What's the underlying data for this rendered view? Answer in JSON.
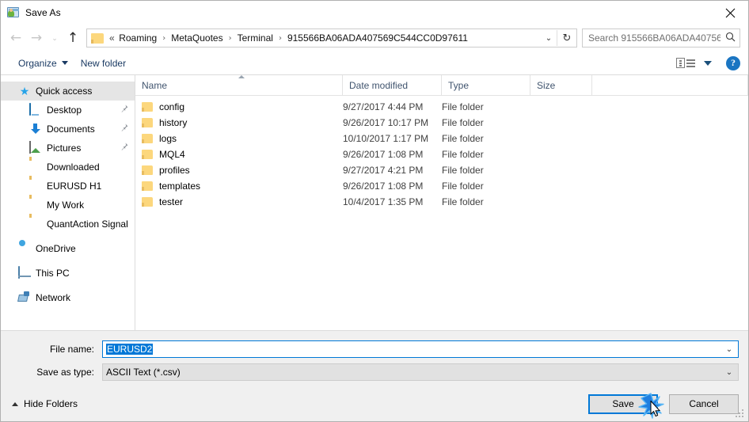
{
  "window": {
    "title": "Save As",
    "icon": "save-as-icon",
    "close_label": "✕"
  },
  "navigation": {
    "back_icon": "←",
    "forward_icon": "→",
    "recent_icon": "⌄",
    "up_icon": "↑",
    "breadcrumb_prefix": "«",
    "breadcrumb_separator": "›",
    "breadcrumbs": [
      "Roaming",
      "MetaQuotes",
      "Terminal",
      "915566BA06ADA407569C544CC0D97611"
    ],
    "dropdown_icon": "⌄",
    "refresh_icon": "↻"
  },
  "search": {
    "placeholder": "Search 915566BA06ADA40756...",
    "icon": "⌕"
  },
  "toolbar": {
    "organize_label": "Organize",
    "new_folder_label": "New folder",
    "view_icon": "view-layout-icon",
    "help_label": "?"
  },
  "sidebar": {
    "items": [
      {
        "label": "Quick access",
        "icon": "star-icon",
        "selected": true,
        "indent": 0,
        "pinned": false
      },
      {
        "label": "Desktop",
        "icon": "desktop-icon",
        "selected": false,
        "indent": 1,
        "pinned": true
      },
      {
        "label": "Documents",
        "icon": "download-icon",
        "selected": false,
        "indent": 1,
        "pinned": true
      },
      {
        "label": "Pictures",
        "icon": "pictures-icon",
        "selected": false,
        "indent": 1,
        "pinned": true
      },
      {
        "label": "Downloaded",
        "icon": "folder-icon",
        "selected": false,
        "indent": 1,
        "pinned": false
      },
      {
        "label": "EURUSD H1",
        "icon": "folder-icon",
        "selected": false,
        "indent": 1,
        "pinned": false
      },
      {
        "label": "My Work",
        "icon": "folder-icon",
        "selected": false,
        "indent": 1,
        "pinned": false
      },
      {
        "label": "QuantAction Signal",
        "icon": "folder-icon",
        "selected": false,
        "indent": 1,
        "pinned": false
      },
      {
        "label": "OneDrive",
        "icon": "cloud-icon",
        "selected": false,
        "indent": 0,
        "pinned": false,
        "group": true
      },
      {
        "label": "This PC",
        "icon": "pc-icon",
        "selected": false,
        "indent": 0,
        "pinned": false,
        "group": true
      },
      {
        "label": "Network",
        "icon": "network-icon",
        "selected": false,
        "indent": 0,
        "pinned": false,
        "group": true
      }
    ],
    "pin_icon": "📌"
  },
  "file_list": {
    "columns": [
      "Name",
      "Date modified",
      "Type",
      "Size"
    ],
    "sort_column": "Name",
    "sort_direction": "ascending",
    "rows": [
      {
        "name": "config",
        "date": "9/27/2017 4:44 PM",
        "type": "File folder",
        "size": ""
      },
      {
        "name": "history",
        "date": "9/26/2017 10:17 PM",
        "type": "File folder",
        "size": ""
      },
      {
        "name": "logs",
        "date": "10/10/2017 1:17 PM",
        "type": "File folder",
        "size": ""
      },
      {
        "name": "MQL4",
        "date": "9/26/2017 1:08 PM",
        "type": "File folder",
        "size": ""
      },
      {
        "name": "profiles",
        "date": "9/27/2017 4:21 PM",
        "type": "File folder",
        "size": ""
      },
      {
        "name": "templates",
        "date": "9/26/2017 1:08 PM",
        "type": "File folder",
        "size": ""
      },
      {
        "name": "tester",
        "date": "10/4/2017 1:35 PM",
        "type": "File folder",
        "size": ""
      }
    ]
  },
  "form": {
    "filename_label": "File name:",
    "filename_value": "EURUSD2",
    "filename_selected": true,
    "savetype_label": "Save as type:",
    "savetype_value": "ASCII Text (*.csv)",
    "chevron_icon": "⌄"
  },
  "footer": {
    "hide_folders_label": "Hide Folders",
    "save_label": "Save",
    "cancel_label": "Cancel",
    "default_button": "Save"
  },
  "colors": {
    "accent": "#0078d7",
    "folder": "#fcd77d",
    "header_text": "#40546e",
    "toolbar_text": "#1a3a63",
    "selected_row": "#e5e5e5",
    "dialog_chrome": "#f0f0f0"
  }
}
